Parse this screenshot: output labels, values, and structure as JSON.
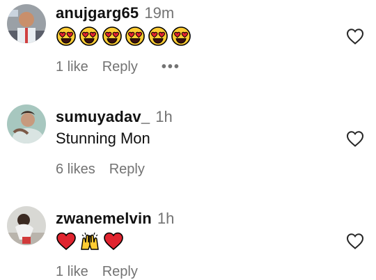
{
  "comments": [
    {
      "username": "anujgarg65",
      "time": "19m",
      "text": "",
      "emojis": [
        "heart-eyes-emoji",
        "heart-eyes-emoji",
        "heart-eyes-emoji",
        "heart-eyes-emoji",
        "heart-eyes-emoji",
        "heart-eyes-emoji"
      ],
      "likes": "1 like",
      "reply": "Reply",
      "more": "•••"
    },
    {
      "username": "sumuyadav_",
      "time": "1h",
      "text": "Stunning Mon",
      "likes": "6 likes",
      "reply": "Reply"
    },
    {
      "username": "zwanemelvin",
      "time": "1h",
      "text": "",
      "emojis": [
        "red-heart-emoji",
        "raising-hands-emoji",
        "red-heart-emoji"
      ],
      "likes": "1 like",
      "reply": "Reply"
    }
  ],
  "colors": {
    "secondary_text": "#737373",
    "heart_outline": "#262626",
    "emoji_yellow": "#FFCC33",
    "emoji_red": "#E0242F"
  }
}
